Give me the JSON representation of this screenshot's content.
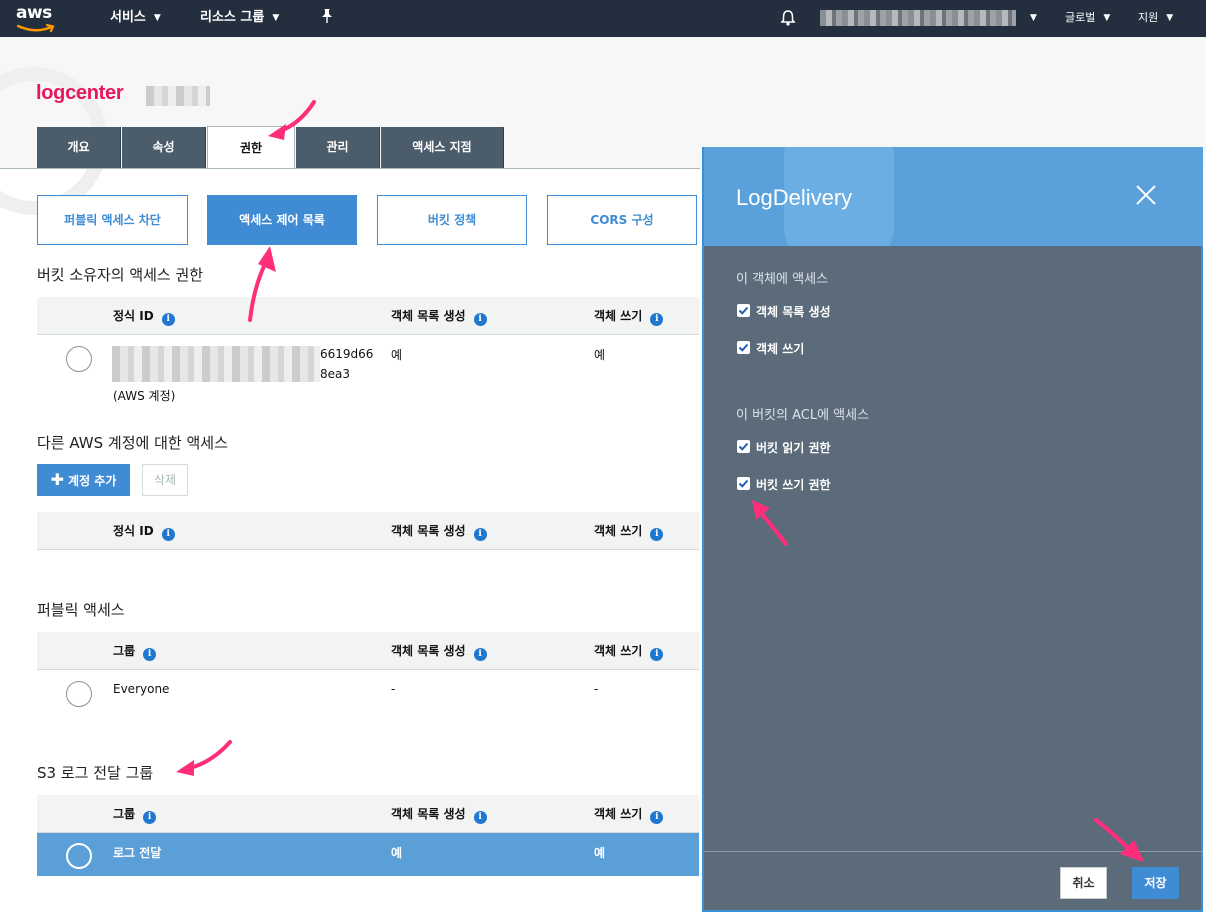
{
  "topnav": {
    "logo": "aws",
    "services": "서비스",
    "resource_groups": "리소스 그룹",
    "pin_icon": "pin-icon",
    "bell_icon": "bell-icon",
    "region": "글로벌",
    "support": "지원"
  },
  "bucket": {
    "name": "logcenter"
  },
  "tabs": [
    {
      "label": "개요"
    },
    {
      "label": "속성"
    },
    {
      "label": "권한"
    },
    {
      "label": "관리"
    },
    {
      "label": "액세스 지점"
    }
  ],
  "subtabs": [
    {
      "label": "퍼블릭 액세스 차단"
    },
    {
      "label": "액세스 제어 목록"
    },
    {
      "label": "버킷 정책"
    },
    {
      "label": "CORS 구성"
    }
  ],
  "owner_section": {
    "title": "버킷 소유자의 액세스 권한",
    "col_id": "정식 ID",
    "col_list": "객체 목록 생성",
    "col_write": "객체 쓰기",
    "row": {
      "id_line1": "6619d66",
      "id_line2": "8ea3",
      "id_note": "(AWS 계정)",
      "list": "예",
      "write": "예"
    }
  },
  "other_section": {
    "title": "다른 AWS 계정에 대한 액세스",
    "add_button": "계정 추가",
    "delete_button": "삭제",
    "col_id": "정식 ID",
    "col_list": "객체 목록 생성",
    "col_write": "객체 쓰기"
  },
  "public_section": {
    "title": "퍼블릭 액세스",
    "col_group": "그룹",
    "col_list": "객체 목록 생성",
    "col_write": "객체 쓰기",
    "row": {
      "group": "Everyone",
      "list": "-",
      "write": "-"
    }
  },
  "s3log_section": {
    "title": "S3 로그 전달 그룹",
    "col_group": "그룹",
    "col_list": "객체 목록 생성",
    "col_write": "객체 쓰기",
    "row": {
      "group": "로그 전달",
      "list": "예",
      "write": "예"
    }
  },
  "panel": {
    "title": "LogDelivery",
    "object_access_title": "이 객체에 액세스",
    "object_list": "객체 목록 생성",
    "object_write": "객체 쓰기",
    "acl_access_title": "이 버킷의 ACL에 액세스",
    "acl_read": "버킷 읽기 권한",
    "acl_write": "버킷 쓰기 권한",
    "cancel": "취소",
    "save": "저장"
  },
  "colors": {
    "nav_bg": "#232f3e",
    "primary": "#3f8bd4",
    "panel_bg": "#5b6b7a",
    "panel_header": "#5aa1dc",
    "annotation": "#e8175d"
  }
}
